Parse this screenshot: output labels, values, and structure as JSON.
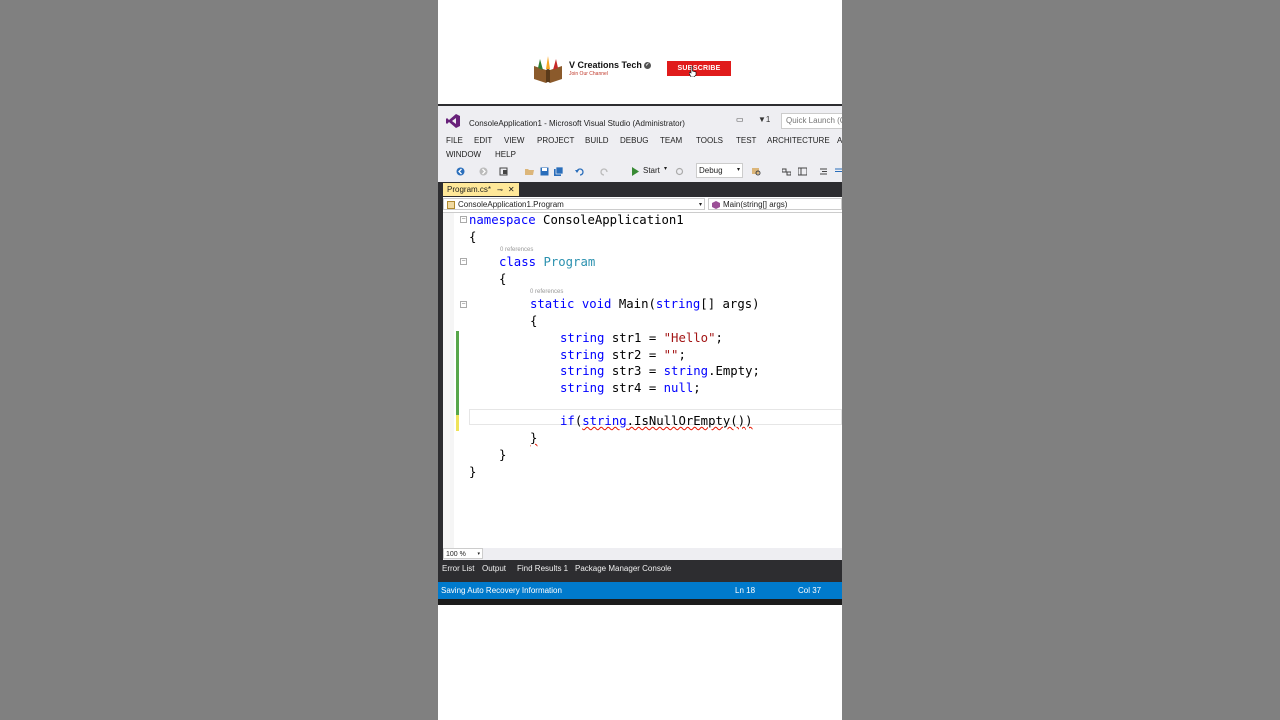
{
  "channel": {
    "name": "V Creations Tech",
    "tagline": "Join Our Channel",
    "subscribe_label": "SUBSCRIBE",
    "accent": "#e01b1b"
  },
  "window": {
    "title": "ConsoleApplication1 - Microsoft Visual Studio (Administrator)",
    "filter_count": "1",
    "quick_launch_placeholder": "Quick Launch (Ctrl+Q)"
  },
  "menu": {
    "items": [
      "FILE",
      "EDIT",
      "VIEW",
      "PROJECT",
      "BUILD",
      "DEBUG",
      "TEAM",
      "TOOLS",
      "TEST",
      "ARCHITECTURE",
      "A",
      "WINDOW",
      "HELP"
    ]
  },
  "toolbar": {
    "start_label": "Start",
    "configuration": "Debug"
  },
  "tab": {
    "label": "Program.cs*",
    "color": "#ffe899"
  },
  "navigation": {
    "type": "ConsoleApplication1.Program",
    "member": "Main(string[] args)"
  },
  "code": {
    "refs": "0 references",
    "tokens": {
      "namespace": "namespace",
      "namespace_name": " ConsoleApplication1",
      "open_brace": "{",
      "close_brace": "}",
      "class": "class",
      "class_name": "Program",
      "static": "static",
      "void": "void",
      "main_sig_a": " Main(",
      "string": "string",
      "main_sig_b": "[] args)",
      "str1": " str1 = ",
      "hello": "\"Hello\"",
      "semi": ";",
      "str2": " str2 = ",
      "empty_lit": "\"\"",
      "str3": " str3 = ",
      "dot_empty": ".Empty;",
      "str4": " str4 = ",
      "null": "null",
      "if": "if",
      "paren": "(",
      "is_null_or_empty": ".IsNullOrEmpty()",
      "close_paren": ")"
    }
  },
  "editor": {
    "zoom": "100 %"
  },
  "bottom_tabs": [
    "Error List",
    "Output",
    "Find Results 1",
    "Package Manager Console"
  ],
  "status": {
    "message": "Saving Auto Recovery Information",
    "line": "Ln 18",
    "col": "Col 37",
    "color": "#007acc"
  }
}
